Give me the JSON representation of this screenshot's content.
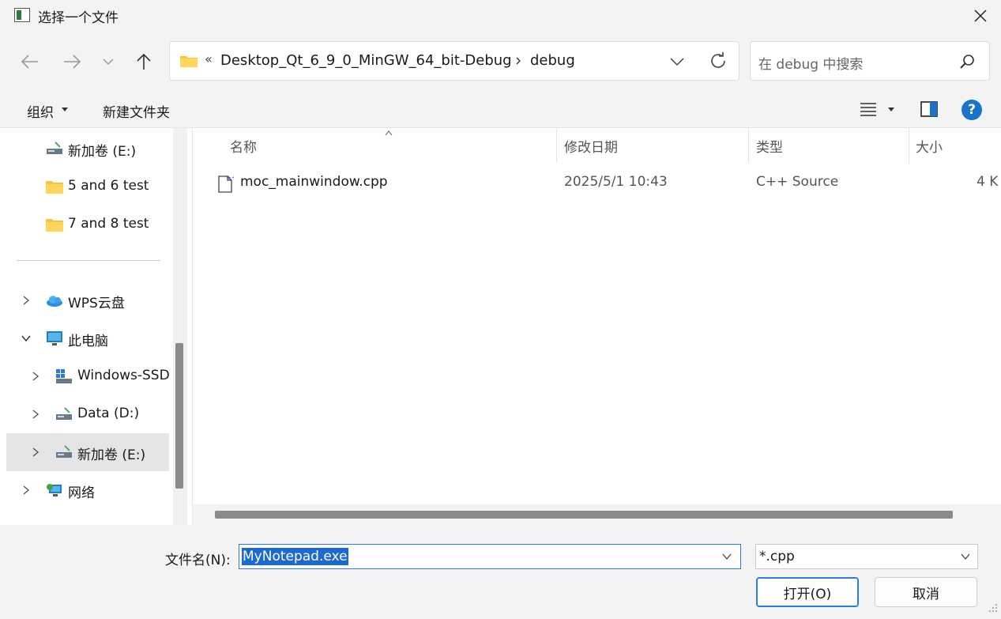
{
  "window": {
    "title": "选择一个文件"
  },
  "address": {
    "ellipsis": "«",
    "segments": [
      "Desktop_Qt_6_9_0_MinGW_64_bit-Debug",
      "debug"
    ]
  },
  "search": {
    "placeholder": "在 debug 中搜索"
  },
  "toolbar": {
    "organize": "组织",
    "new_folder": "新建文件夹",
    "help": "?"
  },
  "sidebar": {
    "items": [
      {
        "label": "新加卷 (E:)",
        "icon": "drive-icon"
      },
      {
        "label": "5 and 6 test",
        "icon": "folder-icon"
      },
      {
        "label": "7 and 8 test",
        "icon": "folder-icon"
      },
      {
        "label": "WPS云盘",
        "icon": "cloud-icon"
      },
      {
        "label": "此电脑",
        "icon": "computer-icon"
      },
      {
        "label": "Windows-SSD",
        "icon": "windows-drive-icon"
      },
      {
        "label": "Data (D:)",
        "icon": "drive-icon"
      },
      {
        "label": "新加卷 (E:)",
        "icon": "drive-icon",
        "selected": true
      },
      {
        "label": "网络",
        "icon": "network-icon"
      }
    ]
  },
  "filelist": {
    "columns": [
      "名称",
      "修改日期",
      "类型",
      "大小"
    ],
    "rows": [
      {
        "name": "moc_mainwindow.cpp",
        "date": "2025/5/1 10:43",
        "type": "C++ Source",
        "size": "4 K"
      }
    ]
  },
  "bottom": {
    "filename_label": "文件名(N):",
    "filename_value": "MyNotepad.exe",
    "filter_value": "*.cpp",
    "open_label": "打开(O)",
    "cancel_label": "取消"
  },
  "colors": {
    "accent": "#1a73c8",
    "selection": "#1c6ad1",
    "folder": "#f6c343"
  }
}
